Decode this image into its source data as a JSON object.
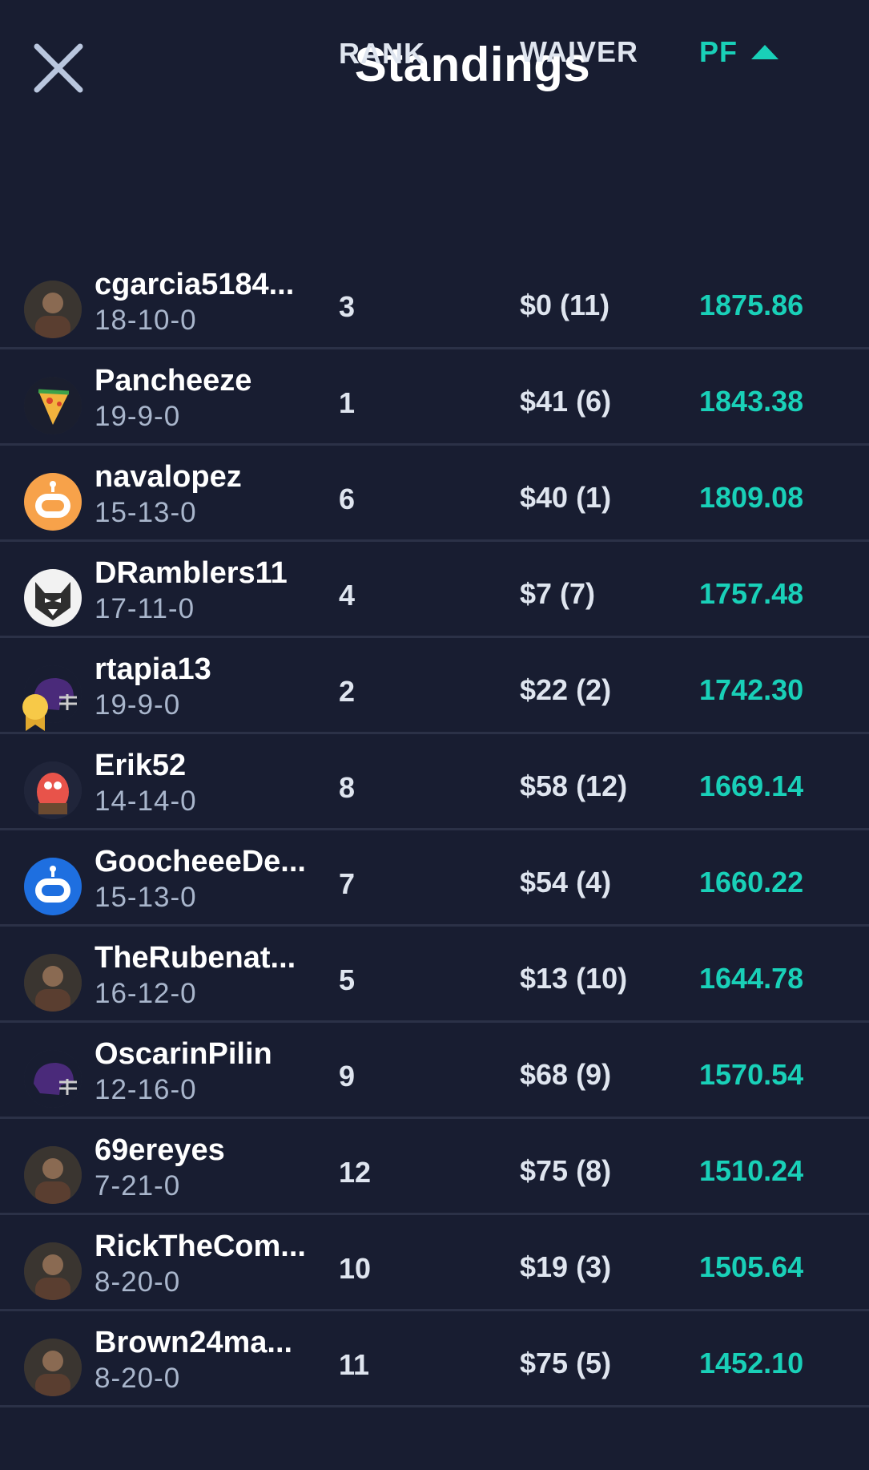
{
  "header": {
    "title": "Standings"
  },
  "columns": {
    "rank": "RANK",
    "waiver": "WAIVER",
    "pf": "PF"
  },
  "colors": {
    "background": "#181d31",
    "accent": "#19d0b8",
    "divider": "#2b3147",
    "muted": "#a9b6cc"
  },
  "rows": [
    {
      "name": "cgarcia5184...",
      "record": "18-10-0",
      "rank": "3",
      "waiver": "$0 (11)",
      "pf": "1875.86",
      "avatar": "photo-avatar"
    },
    {
      "name": "Pancheeze",
      "record": "19-9-0",
      "rank": "1",
      "waiver": "$41 (6)",
      "pf": "1843.38",
      "avatar": "pizza-avatar"
    },
    {
      "name": "navalopez",
      "record": "15-13-0",
      "rank": "6",
      "waiver": "$40 (1)",
      "pf": "1809.08",
      "avatar": "default-orange-avatar"
    },
    {
      "name": "DRamblers11",
      "record": "17-11-0",
      "rank": "4",
      "waiver": "$7 (7)",
      "pf": "1757.48",
      "avatar": "wolf-avatar"
    },
    {
      "name": "rtapia13",
      "record": "19-9-0",
      "rank": "2",
      "waiver": "$22 (2)",
      "pf": "1742.30",
      "avatar": "helmet-avatar"
    },
    {
      "name": "Erik52",
      "record": "14-14-0",
      "rank": "8",
      "waiver": "$58 (12)",
      "pf": "1669.14",
      "avatar": "cartoon-avatar"
    },
    {
      "name": "GoocheeeDe...",
      "record": "15-13-0",
      "rank": "7",
      "waiver": "$54 (4)",
      "pf": "1660.22",
      "avatar": "default-blue-avatar"
    },
    {
      "name": "TheRubenat...",
      "record": "16-12-0",
      "rank": "5",
      "waiver": "$13 (10)",
      "pf": "1644.78",
      "avatar": "photo-avatar"
    },
    {
      "name": "OscarinPilin",
      "record": "12-16-0",
      "rank": "9",
      "waiver": "$68 (9)",
      "pf": "1570.54",
      "avatar": "helmet-avatar"
    },
    {
      "name": "69ereyes",
      "record": "7-21-0",
      "rank": "12",
      "waiver": "$75 (8)",
      "pf": "1510.24",
      "avatar": "photo-avatar"
    },
    {
      "name": "RickTheCom...",
      "record": "8-20-0",
      "rank": "10",
      "waiver": "$19 (3)",
      "pf": "1505.64",
      "avatar": "photo-avatar"
    },
    {
      "name": "Brown24ma...",
      "record": "8-20-0",
      "rank": "11",
      "waiver": "$75 (5)",
      "pf": "1452.10",
      "avatar": "photo-avatar"
    }
  ]
}
